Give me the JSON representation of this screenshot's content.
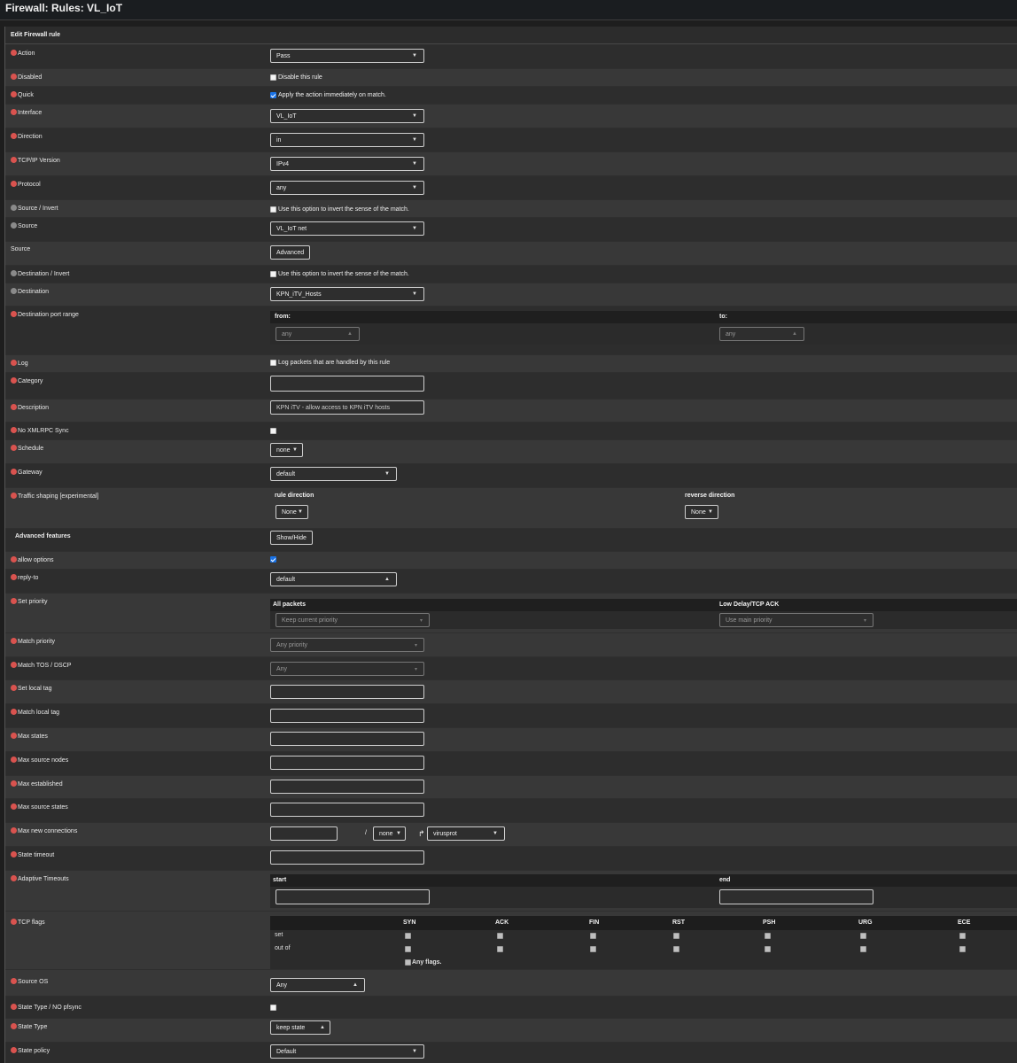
{
  "page": {
    "title": "Firewall: Rules: VL_IoT"
  },
  "panel": {
    "header": "Edit Firewall rule"
  },
  "rows": {
    "action": {
      "label": "Action",
      "value": "Pass"
    },
    "disabled": {
      "label": "Disabled",
      "checkbox_text": "Disable this rule",
      "checked": false
    },
    "quick": {
      "label": "Quick",
      "checkbox_text": "Apply the action immediately on match.",
      "checked": true
    },
    "interface": {
      "label": "Interface",
      "value": "VL_IoT"
    },
    "direction": {
      "label": "Direction",
      "value": "in"
    },
    "tcpip": {
      "label": "TCP/IP Version",
      "value": "IPv4"
    },
    "protocol": {
      "label": "Protocol",
      "value": "any"
    },
    "source_invert": {
      "label": "Source / Invert",
      "checkbox_text": "Use this option to invert the sense of the match.",
      "checked": false
    },
    "source": {
      "label": "Source",
      "value": "VL_IoT net"
    },
    "source_adv": {
      "label": "Source",
      "button": "Advanced"
    },
    "dest_invert": {
      "label": "Destination / Invert",
      "checkbox_text": "Use this option to invert the sense of the match.",
      "checked": false
    },
    "destination": {
      "label": "Destination",
      "value": "KPN_iTV_Hosts"
    },
    "dest_port": {
      "label": "Destination port range",
      "from_label": "from:",
      "to_label": "to:",
      "from_value": "any",
      "to_value": "any"
    },
    "log": {
      "label": "Log",
      "checkbox_text": "Log packets that are handled by this rule",
      "checked": false
    },
    "category": {
      "label": "Category",
      "value": ""
    },
    "description": {
      "label": "Description",
      "value": "KPN iTV - allow access to KPN iTV hosts"
    },
    "no_xmlrpc": {
      "label": "No XMLRPC Sync",
      "checked": false
    },
    "schedule": {
      "label": "Schedule",
      "value": "none"
    },
    "gateway": {
      "label": "Gateway",
      "value": "default"
    },
    "traffic_shaping": {
      "label": "Traffic shaping [experimental]",
      "rule_dir_label": "rule direction",
      "rev_dir_label": "reverse direction",
      "rule_dir_value": "None",
      "rev_dir_value": "None"
    },
    "advanced": {
      "label": "Advanced features",
      "button": "Show/Hide"
    },
    "allow_options": {
      "label": "allow options",
      "checked": true
    },
    "reply_to": {
      "label": "reply-to",
      "value": "default"
    },
    "set_priority": {
      "label": "Set priority",
      "all_label": "All packets",
      "low_label": "Low Delay/TCP ACK",
      "all_value": "Keep current priority",
      "low_value": "Use main priority"
    },
    "match_priority": {
      "label": "Match priority",
      "value": "Any priority"
    },
    "match_tos": {
      "label": "Match TOS / DSCP",
      "value": "Any"
    },
    "set_local_tag": {
      "label": "Set local tag",
      "value": ""
    },
    "match_local_tag": {
      "label": "Match local tag",
      "value": ""
    },
    "max_states": {
      "label": "Max states",
      "value": ""
    },
    "max_src_nodes": {
      "label": "Max source nodes",
      "value": ""
    },
    "max_established": {
      "label": "Max established",
      "value": ""
    },
    "max_src_states": {
      "label": "Max source states",
      "value": ""
    },
    "max_new_conn": {
      "label": "Max new connections",
      "value": "",
      "slash": "/",
      "per_value": "none",
      "table_value": "virusprot"
    },
    "state_timeout": {
      "label": "State timeout",
      "value": ""
    },
    "adaptive": {
      "label": "Adaptive Timeouts",
      "start_label": "start",
      "end_label": "end",
      "start_value": "",
      "end_value": ""
    },
    "tcp_flags": {
      "label": "TCP flags",
      "columns": [
        "SYN",
        "ACK",
        "FIN",
        "RST",
        "PSH",
        "URG",
        "ECE"
      ],
      "row_set": "set",
      "row_outof": "out of",
      "any_flags": "Any flags."
    },
    "source_os": {
      "label": "Source OS",
      "value": "Any"
    },
    "state_type_nopfsync": {
      "label": "State Type / NO pfsync",
      "checked": false
    },
    "state_type": {
      "label": "State Type",
      "value": "keep state"
    },
    "state_policy": {
      "label": "State policy",
      "value": "Default"
    }
  },
  "icons": {
    "info": "info-icon",
    "caret": "caret-down-icon",
    "reply": "reply-arrow-icon"
  },
  "colors": {
    "background": "#383838",
    "alt_row": "#2d2d2d",
    "info_icon": "#d9534f",
    "checkbox_checked": "#1a73e8"
  }
}
